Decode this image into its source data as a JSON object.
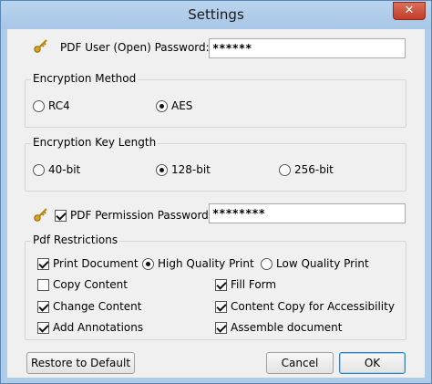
{
  "window": {
    "title": "Settings",
    "close_label": "✕"
  },
  "user_password": {
    "label": "PDF User (Open) Password:",
    "value": "******"
  },
  "encryption_method": {
    "legend": "Encryption Method",
    "options": [
      {
        "label": "RC4",
        "selected": false
      },
      {
        "label": "AES",
        "selected": true
      }
    ]
  },
  "key_length": {
    "legend": "Encryption Key Length",
    "options": [
      {
        "label": "40-bit",
        "selected": false
      },
      {
        "label": "128-bit",
        "selected": true
      },
      {
        "label": "256-bit",
        "selected": false
      }
    ]
  },
  "permission_password": {
    "label": "PDF Permission Password:",
    "checked": true,
    "value": "********"
  },
  "restrictions": {
    "legend": "Pdf Restrictions",
    "print_document": {
      "label": "Print Document",
      "checked": true
    },
    "print_quality": [
      {
        "label": "High Quality Print",
        "selected": true
      },
      {
        "label": "Low Quality Print",
        "selected": false
      }
    ],
    "copy_content": {
      "label": "Copy Content",
      "checked": false
    },
    "fill_form": {
      "label": "Fill Form",
      "checked": true
    },
    "change_content": {
      "label": "Change Content",
      "checked": true
    },
    "content_copy_accessibility": {
      "label": "Content Copy for Accessibility",
      "checked": true
    },
    "add_annotations": {
      "label": "Add Annotations",
      "checked": true
    },
    "assemble_document": {
      "label": "Assemble document",
      "checked": true
    }
  },
  "buttons": {
    "restore": "Restore to Default",
    "cancel": "Cancel",
    "ok": "OK"
  },
  "icons": {
    "key": "key-icon"
  }
}
